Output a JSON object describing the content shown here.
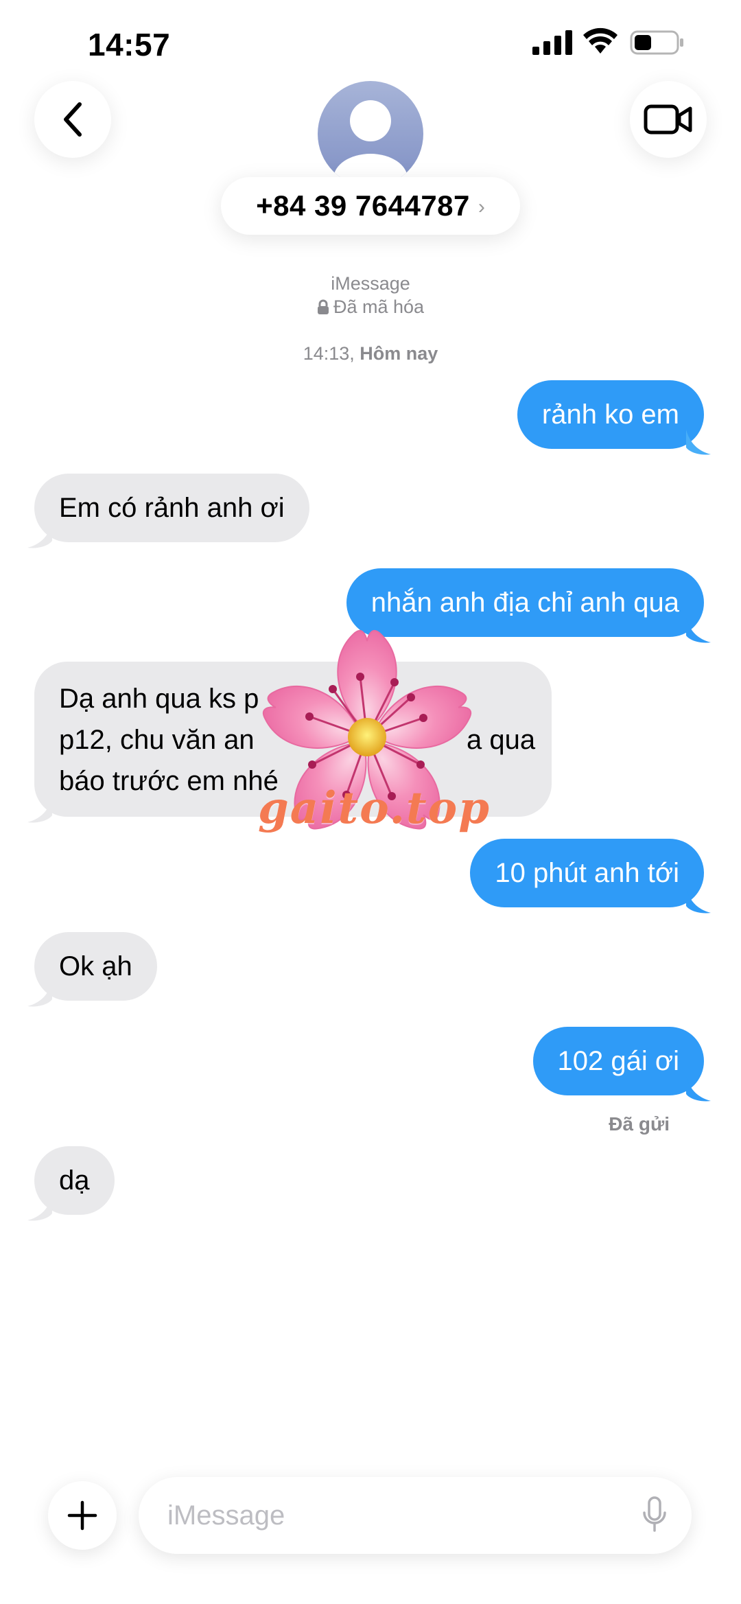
{
  "status_bar": {
    "time": "14:57",
    "icons": [
      "signal-icon",
      "wifi-icon",
      "battery-icon"
    ]
  },
  "header": {
    "back_icon": "chevron-left-icon",
    "video_icon": "video-camera-icon",
    "avatar_icon": "person-icon",
    "contact": "+84 39 7644787",
    "contact_chevron": "›"
  },
  "conversation": {
    "service": "iMessage",
    "encryption": "Đã mã hóa",
    "timestamp_time": "14:13,",
    "timestamp_day": "Hôm nay",
    "messages": [
      {
        "direction": "outgoing",
        "text": "rảnh ko em"
      },
      {
        "direction": "incoming",
        "text": "Em có rảnh anh ơi"
      },
      {
        "direction": "outgoing",
        "text": "nhắn anh địa chỉ anh qua"
      },
      {
        "direction": "incoming",
        "text": "Dạ anh qua ks p\np12, chu văn an\nbáo trước em nhé"
      },
      {
        "direction": "outgoing",
        "text": "10 phút anh tới"
      },
      {
        "direction": "incoming",
        "text": "Ok ạh"
      },
      {
        "direction": "outgoing",
        "text": "102 gái ơi"
      },
      {
        "direction": "incoming",
        "text": "dạ"
      }
    ],
    "partial_text_right": "a qua",
    "delivery_status": "Đã gửi"
  },
  "watermark": {
    "text": "gaito.top"
  },
  "input_bar": {
    "placeholder": "iMessage",
    "plus_icon": "plus-icon",
    "mic_icon": "microphone-icon"
  },
  "colors": {
    "outgoing_bubble": "#2f9bf7",
    "incoming_bubble": "#e9e9eb",
    "meta_text": "#8a8a8e",
    "watermark_text": "#f47a52"
  }
}
